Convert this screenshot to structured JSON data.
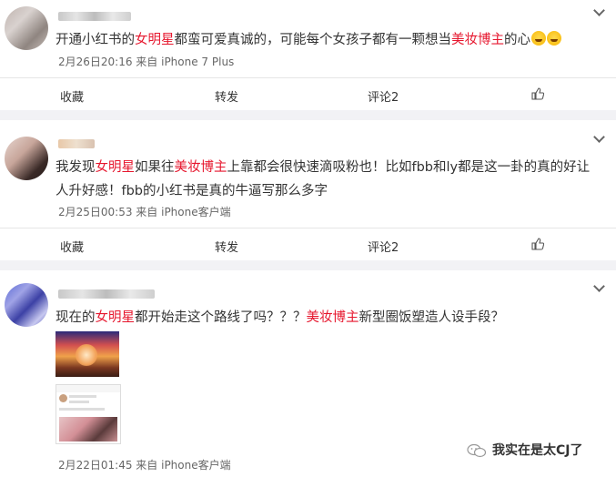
{
  "posts": [
    {
      "text_parts": [
        "开通小红书的",
        "女明星",
        "都蛮可爱真诚的，可能每个女孩子都有一颗想当",
        "美妆博主",
        "的心"
      ],
      "meta": "2月26日20:16 来自 iPhone 7 Plus",
      "actions": {
        "favorite": "收藏",
        "forward": "转发",
        "comment": "评论2"
      }
    },
    {
      "text_parts": [
        "我发现",
        "女明星",
        "如果往",
        "美妆博主",
        "上靠都会很快速滴吸粉也！比如fbb和ly都是这一卦的真的好让人升好感！fbb的小红书是真的牛逼写那么多字"
      ],
      "meta": "2月25日00:53 来自 iPhone客户端",
      "actions": {
        "favorite": "收藏",
        "forward": "转发",
        "comment": "评论2"
      }
    },
    {
      "text_parts": [
        "现在的",
        "女明星",
        "都开始走这个路线了吗？？？",
        "美妆博主",
        "新型圈饭塑造人设手段？"
      ],
      "meta": "2月22日01:45 来自 iPhone客户端"
    }
  ],
  "watermark": "我实在是太CJ了",
  "icons": [
    "chevron-down-icon",
    "thumbs-up-icon",
    "laugh-cry-emoji",
    "wechat-icon"
  ],
  "colors": {
    "highlight": "#e6162d",
    "meta": "#666666",
    "background": "#f2f2f5"
  }
}
